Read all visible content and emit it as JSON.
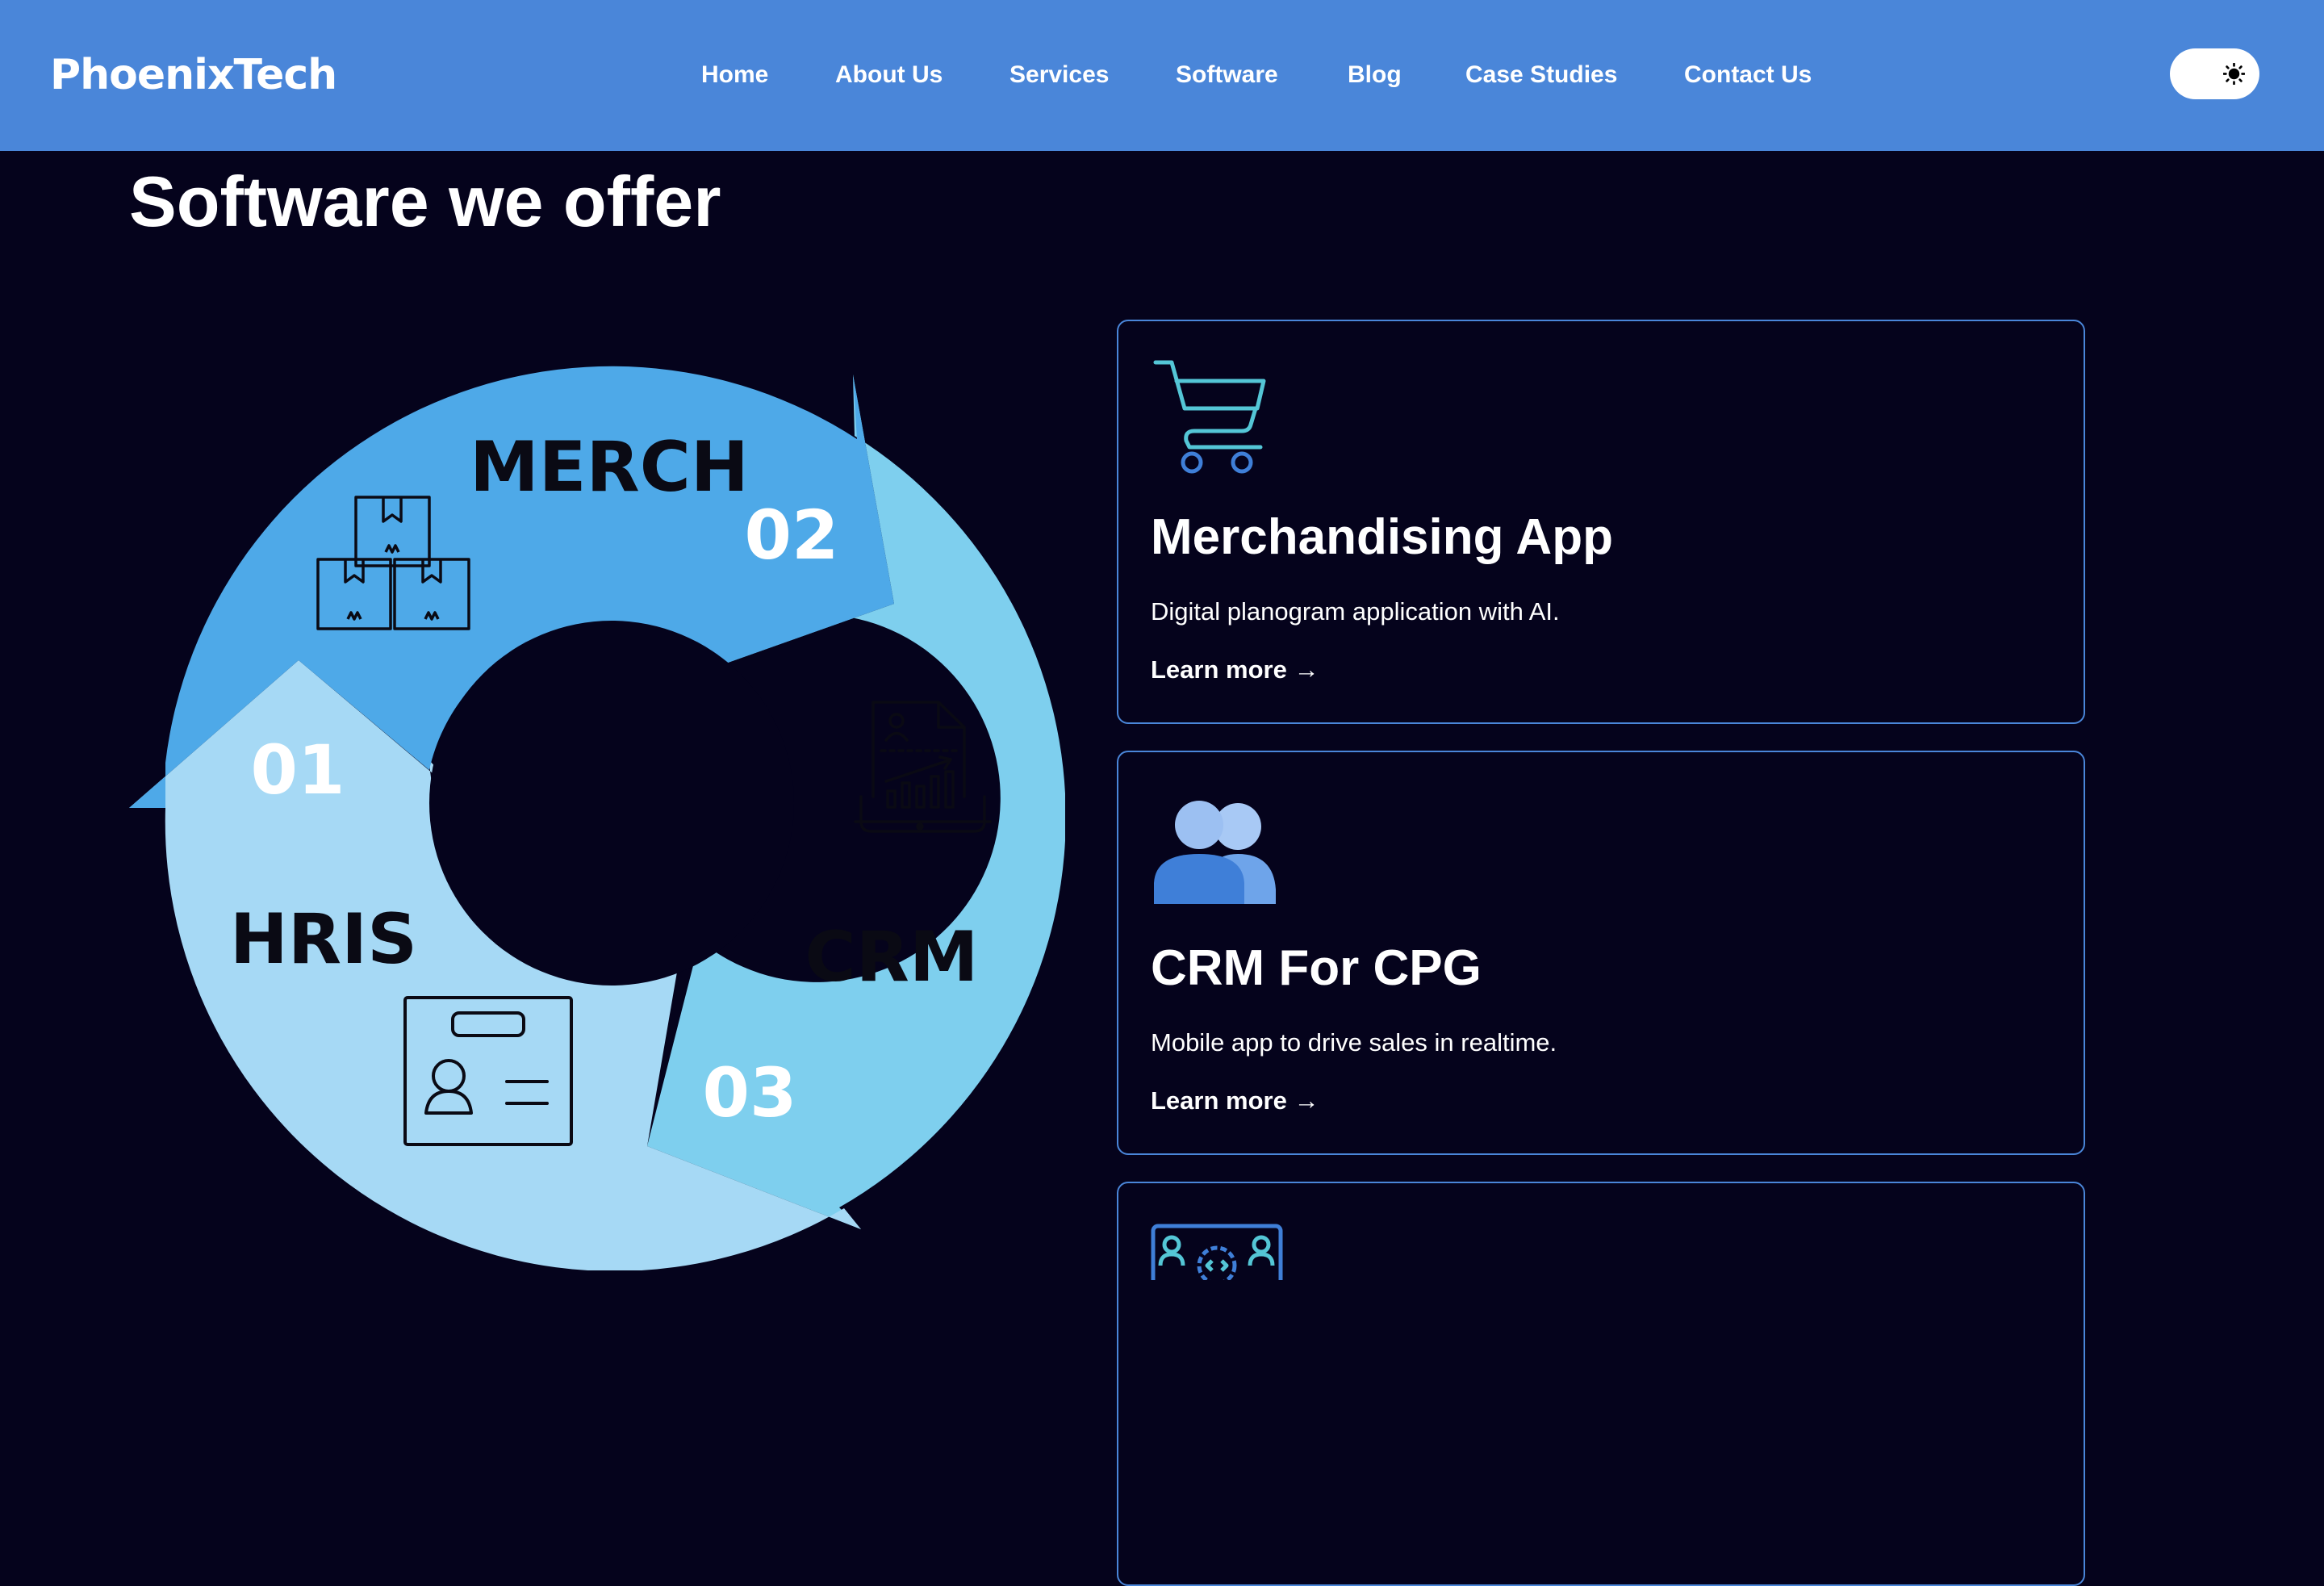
{
  "header": {
    "logo": "PhoenixTech",
    "nav": [
      {
        "label": "Home"
      },
      {
        "label": "About Us"
      },
      {
        "label": "Services"
      },
      {
        "label": "Software"
      },
      {
        "label": "Blog"
      },
      {
        "label": "Case Studies"
      },
      {
        "label": "Contact Us"
      }
    ],
    "theme_toggle_icon": "sun-icon"
  },
  "main": {
    "title": "Software we offer",
    "diagram": {
      "segments": [
        {
          "number": "01",
          "label": "HRIS",
          "icon": "id-badge-icon"
        },
        {
          "number": "02",
          "label": "MERCH",
          "icon": "stacked-boxes-icon"
        },
        {
          "number": "03",
          "label": "CRM",
          "icon": "sales-report-icon"
        }
      ]
    },
    "cards": [
      {
        "icon": "shopping-cart-icon",
        "title": "Merchandising App",
        "description": "Digital planogram application with AI.",
        "link": "Learn more →"
      },
      {
        "icon": "users-icon",
        "title": "CRM For CPG",
        "description": "Mobile app to drive sales in realtime.",
        "link": "Learn more →"
      },
      {
        "icon": "dev-team-icon"
      }
    ]
  },
  "colors": {
    "header_bg": "#4a86d9",
    "page_bg": "#05031c",
    "card_border": "#4a86d9",
    "segment_merch": "#4ea9e8",
    "segment_crm": "#7ecfee",
    "segment_hris": "#a6d9f5",
    "icon_teal": "#54c6d6",
    "icon_blue": "#3f7fd8"
  }
}
